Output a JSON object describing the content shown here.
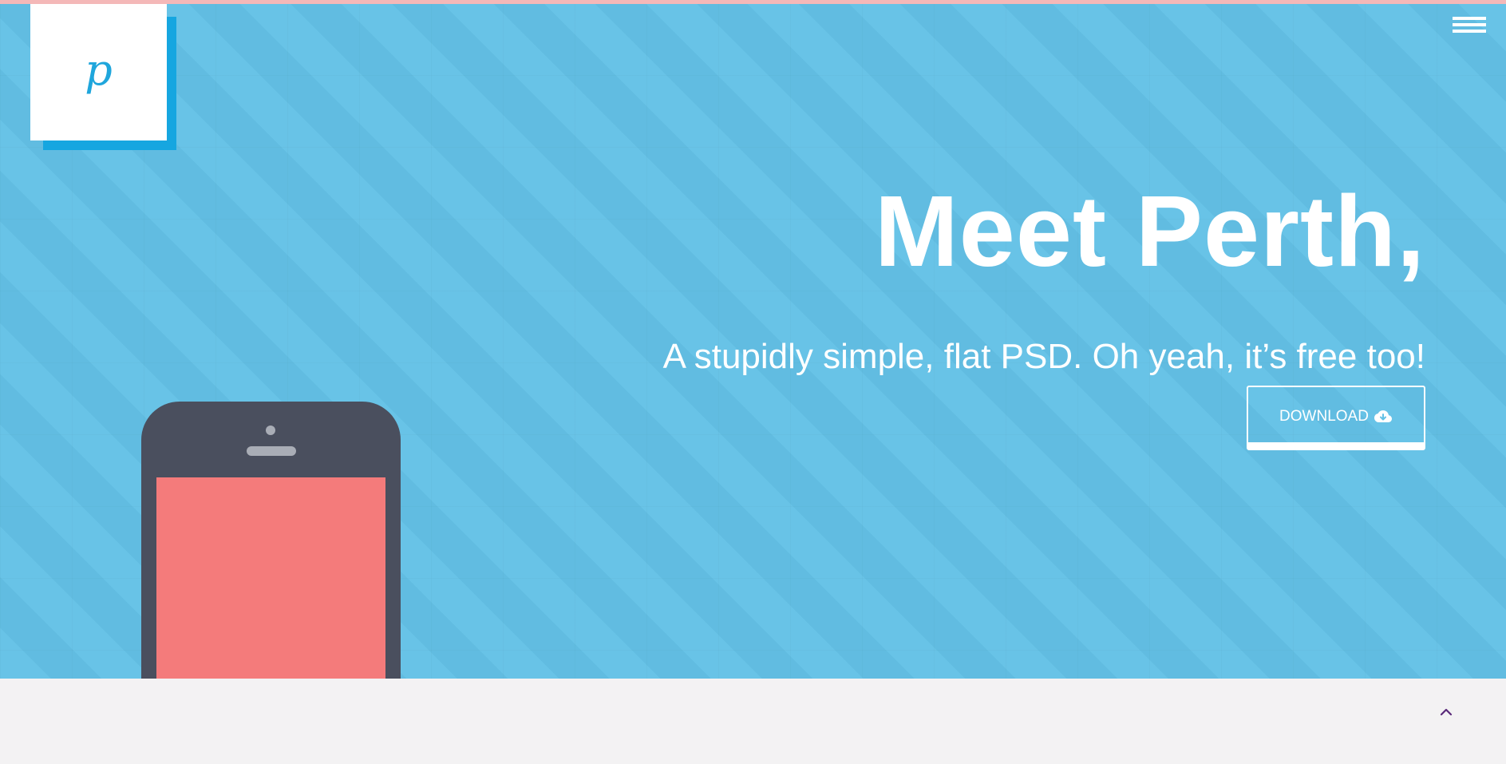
{
  "logo": {
    "letter": "p"
  },
  "nav": {
    "menu_icon": "hamburger-icon"
  },
  "hero": {
    "headline": "Meet Perth,",
    "tagline": "A stupidly simple, flat PSD. Oh yeah, it’s free too!",
    "download_label": "DOWNLOAD",
    "download_icon": "cloud-download-icon"
  },
  "footer": {
    "scroll_icon": "chevron-up-icon"
  },
  "colors": {
    "hero_bg": "#63c1e6",
    "logo_accent": "#16a6e0",
    "phone_body": "#4a4f5e",
    "phone_screen": "#f47b7b",
    "footer_bg": "#f3f2f3",
    "chevron": "#5a2a7a"
  }
}
